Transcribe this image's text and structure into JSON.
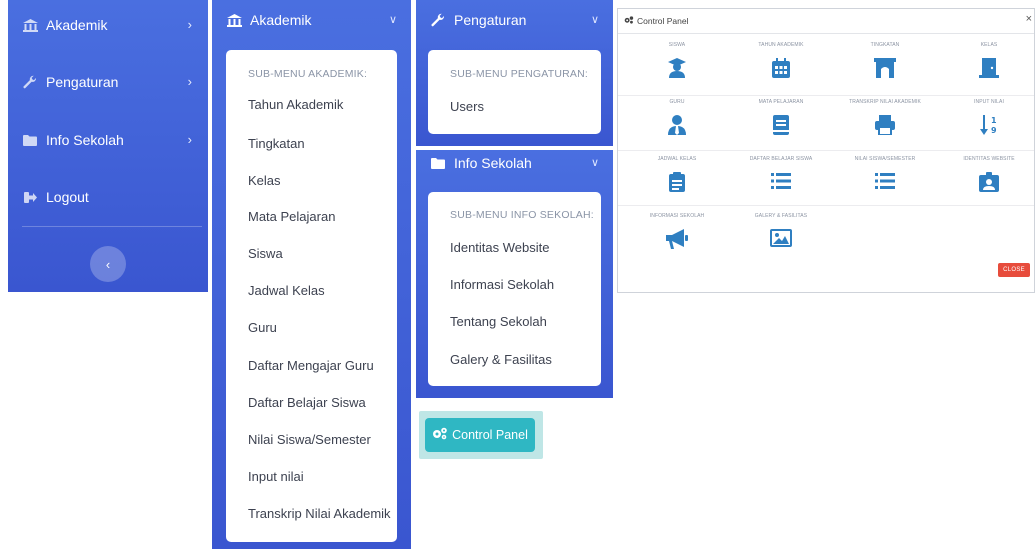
{
  "panel1": {
    "items": [
      {
        "label": "Akademik",
        "icon": "university-icon",
        "has_chevron": true
      },
      {
        "label": "Pengaturan",
        "icon": "wrench-icon",
        "has_chevron": true
      },
      {
        "label": "Info Sekolah",
        "icon": "folder-icon",
        "has_chevron": true
      },
      {
        "label": "Logout",
        "icon": "sign-out-icon",
        "has_chevron": false
      }
    ],
    "collapse_icon": "chevron-left-icon"
  },
  "akademik_menu": {
    "header": "Akademik",
    "submenu_title": "SUB-MENU AKADEMIK:",
    "items": [
      "Tahun Akademik",
      "Tingkatan",
      "Kelas",
      "Mata Pelajaran",
      "Siswa",
      "Jadwal Kelas",
      "Guru",
      "Daftar Mengajar Guru",
      "Daftar Belajar Siswa",
      "Nilai Siswa/Semester",
      "Input nilai",
      "Transkrip Nilai Akademik"
    ]
  },
  "pengaturan_menu": {
    "header": "Pengaturan",
    "submenu_title": "SUB-MENU PENGATURAN:",
    "items": [
      "Users"
    ]
  },
  "info_menu": {
    "header": "Info Sekolah",
    "submenu_title": "SUB-MENU INFO SEKOLAH:",
    "items": [
      "Identitas Website",
      "Informasi Sekolah",
      "Tentang Sekolah",
      "Galery & Fasilitas"
    ]
  },
  "control_panel_button": {
    "label": "Control Panel",
    "icon": "cogs-icon"
  },
  "modal": {
    "title": "Control Panel",
    "close_x": "×",
    "close_button": "CLOSE",
    "tiles": [
      {
        "label": "SISWA",
        "icon": "graduate-icon"
      },
      {
        "label": "TAHUN AKADEMIK",
        "icon": "calendar-icon"
      },
      {
        "label": "TINGKATAN",
        "icon": "archway-icon"
      },
      {
        "label": "KELAS",
        "icon": "door-icon"
      },
      {
        "label": "GURU",
        "icon": "user-tie-icon"
      },
      {
        "label": "MATA PELAJARAN",
        "icon": "book-icon"
      },
      {
        "label": "TRANSKRIP NILAI AKADEMIK",
        "icon": "print-icon"
      },
      {
        "label": "INPUT NILAI",
        "icon": "sort-numeric-icon"
      },
      {
        "label": "JADWAL KELAS",
        "icon": "clipboard-icon"
      },
      {
        "label": "DAFTAR BELAJAR SISWA",
        "icon": "list-icon"
      },
      {
        "label": "NILAI SISWA/SEMESTER",
        "icon": "list-icon"
      },
      {
        "label": "IDENTITAS WEBSITE",
        "icon": "id-badge-icon"
      },
      {
        "label": "INFORMASI SEKOLAH",
        "icon": "bullhorn-icon"
      },
      {
        "label": "GALERY & FASILITAS",
        "icon": "image-icon"
      }
    ]
  },
  "colors": {
    "sidebar": "#3f61db",
    "icon_blue": "#2f7fc1",
    "button_teal": "#2fb7c3",
    "close_red": "#e74c3c"
  }
}
